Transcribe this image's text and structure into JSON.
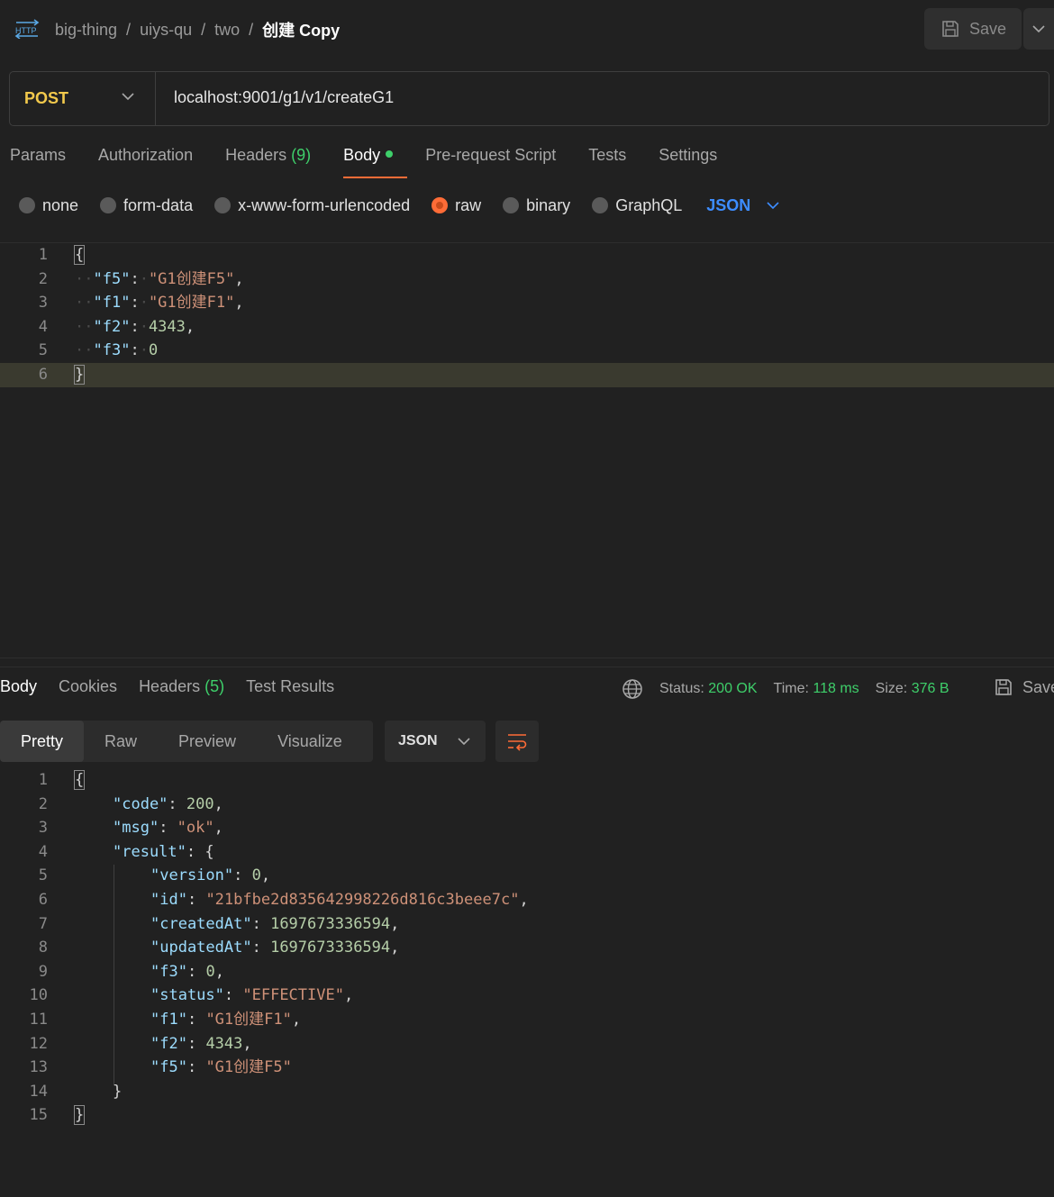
{
  "header": {
    "icon": "http-icon",
    "breadcrumb": [
      "big-thing",
      "uiys-qu",
      "two"
    ],
    "separator": "/",
    "title": "创建 Copy",
    "save_label": "Save"
  },
  "request": {
    "method": "POST",
    "url": "localhost:9001/g1/v1/createG1",
    "tabs": {
      "params": "Params",
      "authorization": "Authorization",
      "headers": "Headers",
      "headers_count": "(9)",
      "body": "Body",
      "prerequest": "Pre-request Script",
      "tests": "Tests",
      "settings": "Settings"
    },
    "body_types": {
      "none": "none",
      "form_data": "form-data",
      "urlencoded": "x-www-form-urlencoded",
      "raw": "raw",
      "binary": "binary",
      "graphql": "GraphQL"
    },
    "selected_body_type": "raw",
    "language": "JSON",
    "body_lines": [
      {
        "n": "1"
      },
      {
        "n": "2",
        "key": "\"f5\"",
        "val": "\"G1创建F5\"",
        "type": "str",
        "comma": ","
      },
      {
        "n": "3",
        "key": "\"f1\"",
        "val": "\"G1创建F1\"",
        "type": "str",
        "comma": ","
      },
      {
        "n": "4",
        "key": "\"f2\"",
        "val": "4343",
        "type": "num",
        "comma": ","
      },
      {
        "n": "5",
        "key": "\"f3\"",
        "val": "0",
        "type": "num",
        "comma": ""
      },
      {
        "n": "6"
      }
    ]
  },
  "response": {
    "tabs": {
      "body": "Body",
      "cookies": "Cookies",
      "headers": "Headers",
      "headers_count": "(5)",
      "test_results": "Test Results"
    },
    "status_label": "Status:",
    "status_value": "200 OK",
    "time_label": "Time:",
    "time_value": "118 ms",
    "size_label": "Size:",
    "size_value": "376 B",
    "save_label": "Save",
    "view_tabs": {
      "pretty": "Pretty",
      "raw": "Raw",
      "preview": "Preview",
      "visualize": "Visualize"
    },
    "format": "JSON",
    "lines": [
      {
        "n": "1",
        "text": "{"
      },
      {
        "n": "2",
        "key": "\"code\"",
        "val": "200",
        "type": "num",
        "comma": ","
      },
      {
        "n": "3",
        "key": "\"msg\"",
        "val": "\"ok\"",
        "type": "str",
        "comma": ","
      },
      {
        "n": "4",
        "key": "\"result\"",
        "val": "{",
        "type": "pun",
        "comma": ""
      },
      {
        "n": "5",
        "key": "\"version\"",
        "val": "0",
        "type": "num",
        "comma": ","
      },
      {
        "n": "6",
        "key": "\"id\"",
        "val": "\"21bfbe2d835642998226d816c3beee7c\"",
        "type": "str",
        "comma": ","
      },
      {
        "n": "7",
        "key": "\"createdAt\"",
        "val": "1697673336594",
        "type": "num",
        "comma": ","
      },
      {
        "n": "8",
        "key": "\"updatedAt\"",
        "val": "1697673336594",
        "type": "num",
        "comma": ","
      },
      {
        "n": "9",
        "key": "\"f3\"",
        "val": "0",
        "type": "num",
        "comma": ","
      },
      {
        "n": "10",
        "key": "\"status\"",
        "val": "\"EFFECTIVE\"",
        "type": "str",
        "comma": ","
      },
      {
        "n": "11",
        "key": "\"f1\"",
        "val": "\"G1创建F1\"",
        "type": "str",
        "comma": ","
      },
      {
        "n": "12",
        "key": "\"f2\"",
        "val": "4343",
        "type": "num",
        "comma": ","
      },
      {
        "n": "13",
        "key": "\"f5\"",
        "val": "\"G1创建F5\"",
        "type": "str",
        "comma": ""
      },
      {
        "n": "14",
        "text": "}"
      },
      {
        "n": "15",
        "text": "}"
      }
    ]
  },
  "colors": {
    "background": "#212121",
    "accent": "#ff6c37",
    "method_post": "#f2c94c",
    "success": "#3ecf6a",
    "link_blue": "#3d8dff"
  }
}
